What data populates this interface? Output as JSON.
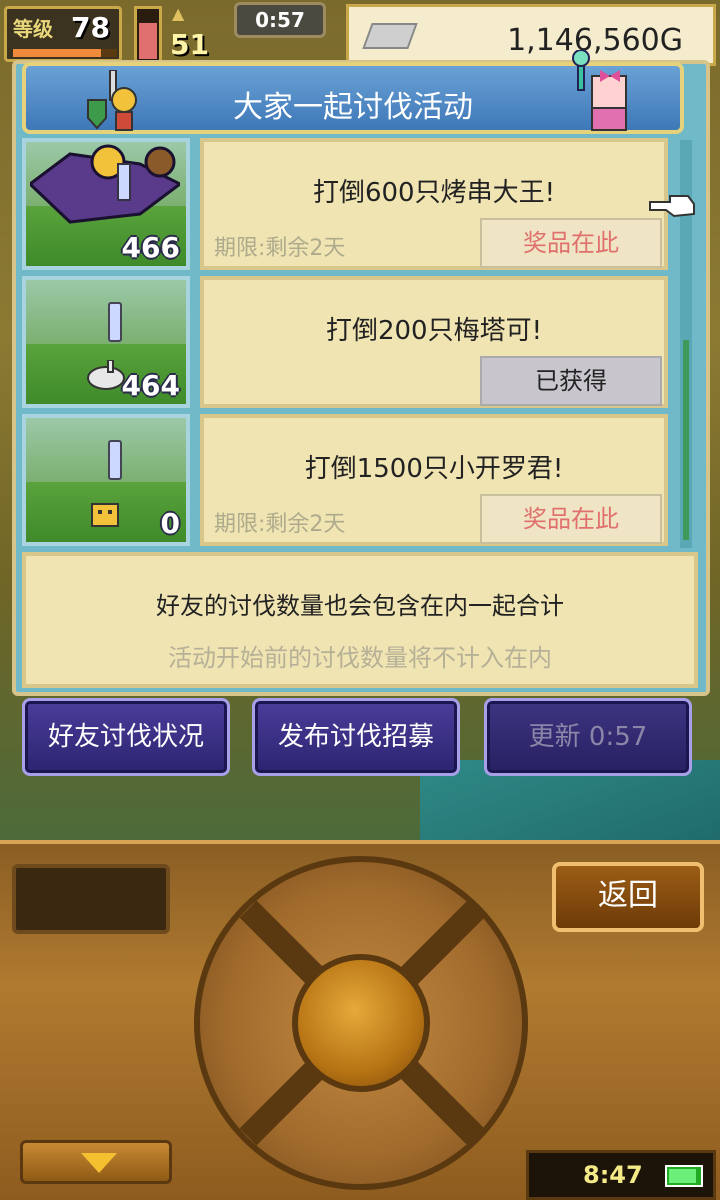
{
  "hud": {
    "level_label": "等级",
    "level": "78",
    "stat_value": "51",
    "timer": "0:57",
    "money": "1,146,560G"
  },
  "panel": {
    "title": "大家一起讨伐活动"
  },
  "quests": [
    {
      "text": "打倒600只烤串大王!",
      "count": "466",
      "deadline": "期限:剩余2天",
      "reward_label": "奖品在此",
      "claimed": false
    },
    {
      "text": "打倒200只梅塔可!",
      "count": "464",
      "deadline": "",
      "reward_label": "已获得",
      "claimed": true
    },
    {
      "text": "打倒1500只小开罗君!",
      "count": "0",
      "deadline": "期限:剩余2天",
      "reward_label": "奖品在此",
      "claimed": false
    }
  ],
  "info": {
    "line1": "好友的讨伐数量也会包含在内一起合计",
    "line2": "活动开始前的讨伐数量将不计入在内"
  },
  "buttons": {
    "friend_status": "好友讨伐状况",
    "post_recruit": "发布讨伐招募",
    "refresh": "更新 0:57"
  },
  "controller": {
    "back_label": "返回",
    "clock": "8:47"
  },
  "colors": {
    "reward_text": "#e07070",
    "button_bg": "#2b2470",
    "panel_bg": "#6fb9c9"
  }
}
